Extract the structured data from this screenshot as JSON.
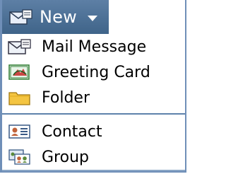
{
  "toolbar": {
    "new_label": "New"
  },
  "menu": {
    "items": [
      {
        "label": "Mail Message",
        "icon": "mail-message-icon"
      },
      {
        "label": "Greeting Card",
        "icon": "greeting-card-icon"
      },
      {
        "label": "Folder",
        "icon": "folder-icon"
      },
      {
        "label": "Contact",
        "icon": "contact-icon"
      },
      {
        "label": "Group",
        "icon": "group-icon"
      }
    ]
  },
  "colors": {
    "toolbar_bg": "#4a6f96",
    "separator": "#5e82ab"
  }
}
